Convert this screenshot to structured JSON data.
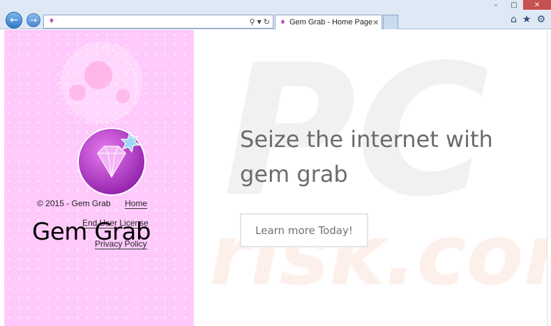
{
  "browser": {
    "address_value": "",
    "tab_title": "Gem Grab - Home Page",
    "window_controls": [
      "minimize-icon",
      "maximize-icon",
      "close-icon"
    ],
    "toolbar_icons": [
      "home-icon",
      "star-icon",
      "gear-icon"
    ],
    "colors": {
      "chrome": "#dfe9f5",
      "nav_button": "#3a84d4",
      "close": "#c75050"
    }
  },
  "sidebar": {
    "copyright": "© 2015 - Gem Grab",
    "links": {
      "home": "Home",
      "eula": "End User License",
      "privacy": "Privacy Policy"
    },
    "brand_name": "Gem Grab",
    "colors": {
      "background": "#ffc9fb",
      "gem": "#b43cc8"
    }
  },
  "main": {
    "headline": "Seize the internet with gem grab",
    "cta_label": "Learn more Today!",
    "watermark_text": "PC risk.com",
    "colors": {
      "headline": "#6b6b6b",
      "cta_border": "#e5e5e5"
    }
  }
}
